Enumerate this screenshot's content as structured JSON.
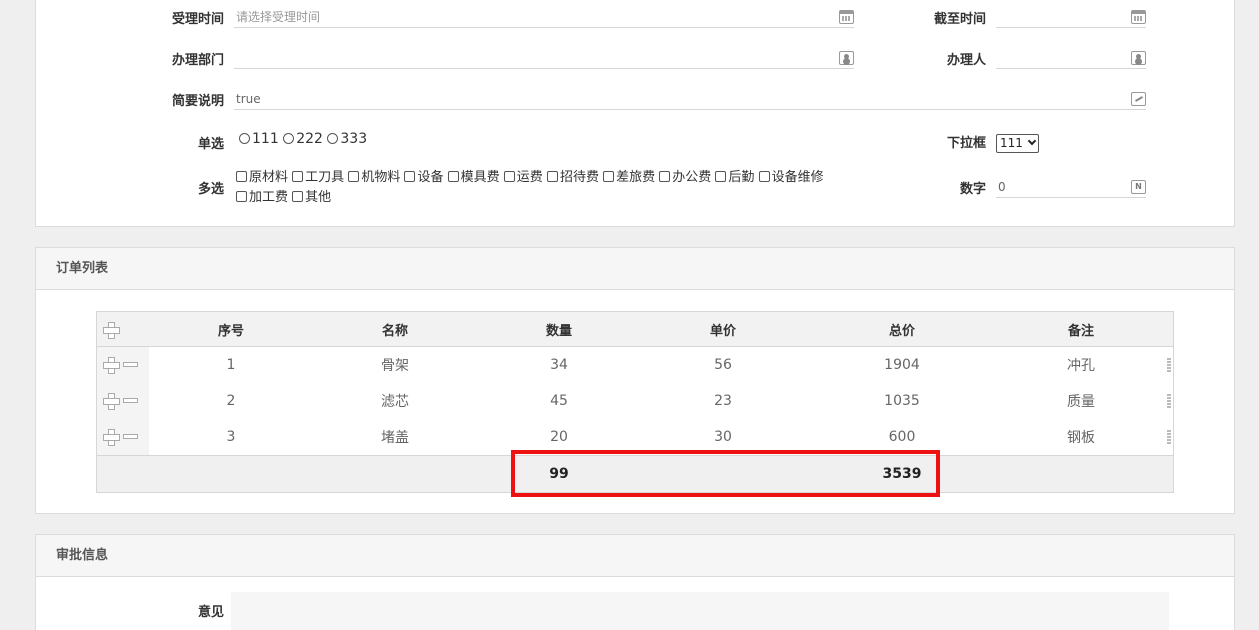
{
  "form": {
    "accept_time": {
      "label": "受理时间",
      "placeholder": "请选择受理时间",
      "icon": "calendar-icon"
    },
    "deadline": {
      "label": "截至时间",
      "value": "",
      "icon": "calendar-icon"
    },
    "department": {
      "label": "办理部门",
      "value": "",
      "icon": "user-picker-icon"
    },
    "handler": {
      "label": "办理人",
      "value": "",
      "icon": "user-picker-icon"
    },
    "summary": {
      "label": "简要说明",
      "value": "true",
      "icon": "edit-icon"
    },
    "single": {
      "label": "单选",
      "options": [
        "111",
        "222",
        "333"
      ]
    },
    "dropdown": {
      "label": "下拉框",
      "selected": "111"
    },
    "multi": {
      "label": "多选",
      "options": [
        "原材料",
        "工刀具",
        "机物料",
        "设备",
        "模具费",
        "运费",
        "招待费",
        "差旅费",
        "办公费",
        "后勤",
        "设备维修",
        "加工费",
        "其他"
      ]
    },
    "number": {
      "label": "数字",
      "value": "0",
      "icon": "number-icon"
    }
  },
  "orders": {
    "title": "订单列表",
    "columns": [
      "序号",
      "名称",
      "数量",
      "单价",
      "总价",
      "备注"
    ],
    "rows": [
      [
        "1",
        "骨架",
        "34",
        "56",
        "1904",
        "冲孔"
      ],
      [
        "2",
        "滤芯",
        "45",
        "23",
        "1035",
        "质量"
      ],
      [
        "3",
        "堵盖",
        "20",
        "30",
        "600",
        "钢板"
      ]
    ],
    "totals": {
      "quantity": "99",
      "total_price": "3539"
    },
    "highlight_color": "#ee1111"
  },
  "approval": {
    "title": "审批信息",
    "opinion_label": "意见"
  }
}
